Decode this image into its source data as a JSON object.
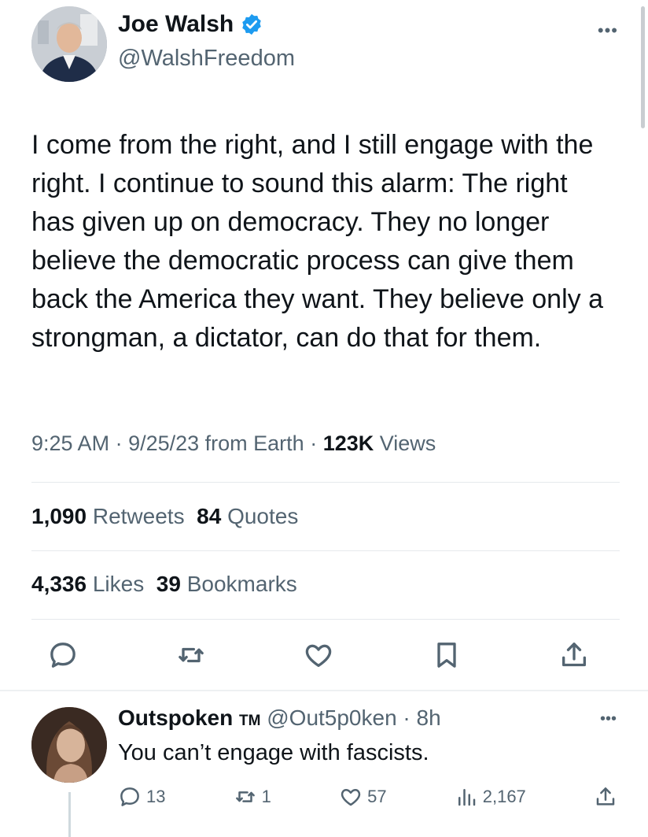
{
  "tweet": {
    "author": {
      "name": "Joe Walsh",
      "handle": "@WalshFreedom",
      "verified": true,
      "avatar": "man-in-suit-photo"
    },
    "text": "I come from the right, and I still engage with the right. I continue to sound this alarm: The right has given up on democracy. They no longer believe the democratic process can give them back the America they want. They believe only a strongman, a dictator, can do that for them.",
    "meta": {
      "time": "9:25 AM",
      "separator1": " · ",
      "date": "9/25/23",
      "source": " from Earth",
      "separator2": " · ",
      "views_count": "123K",
      "views_label": " Views"
    },
    "stats": {
      "retweets_count": "1,090",
      "retweets_label": " Retweets",
      "quotes_count": "84",
      "quotes_label": " Quotes",
      "likes_count": "4,336",
      "likes_label": " Likes",
      "bookmarks_count": "39",
      "bookmarks_label": " Bookmarks"
    },
    "actions": [
      "reply-icon",
      "retweet-icon",
      "like-icon",
      "bookmark-icon",
      "share-icon"
    ]
  },
  "reply": {
    "name": "Outspoken",
    "tm": "TM",
    "handle": "@Out5p0ken",
    "separator": " · ",
    "time": "8h",
    "text": "You can’t engage with fascists.",
    "reply_count": "13",
    "retweet_count": "1",
    "like_count": "57",
    "views_count": "2,167",
    "avatar": "woman-photo"
  },
  "colors": {
    "text_primary": "#0f1419",
    "text_secondary": "#536471",
    "verified_badge": "#1d9bf0",
    "divider": "#e6e9ec"
  }
}
